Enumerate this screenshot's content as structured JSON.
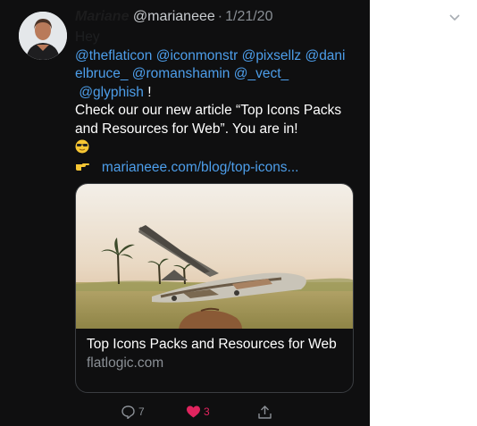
{
  "tweet": {
    "author_name": "Mariane",
    "handle": "@marianeee",
    "separator": "·",
    "date": "1/21/20",
    "greeting": "Hey",
    "mentions": [
      "@theflaticon",
      "@iconmonstr",
      "@pixsellz",
      "@danielbruce_",
      "@romanshamin",
      "@_vect_",
      "@glyphish"
    ],
    "after_mentions": "!",
    "body": "Check our our new article “Top Icons Packs and Resources for Web”. You are in!",
    "link": "marianeee.com/blog/top-icons...",
    "emoji_1": "sunglasses-emoji",
    "emoji_2": "pointing-hand-emoji"
  },
  "card": {
    "title": "Top Icons Packs and Resources for Web",
    "domain": "flatlogic.com"
  },
  "actions": {
    "reply_count": "7",
    "like_count": "3"
  },
  "colors": {
    "background": "#0f0f10",
    "link": "#4d9eea",
    "like": "#e0245e",
    "muted": "#8a8f95"
  }
}
